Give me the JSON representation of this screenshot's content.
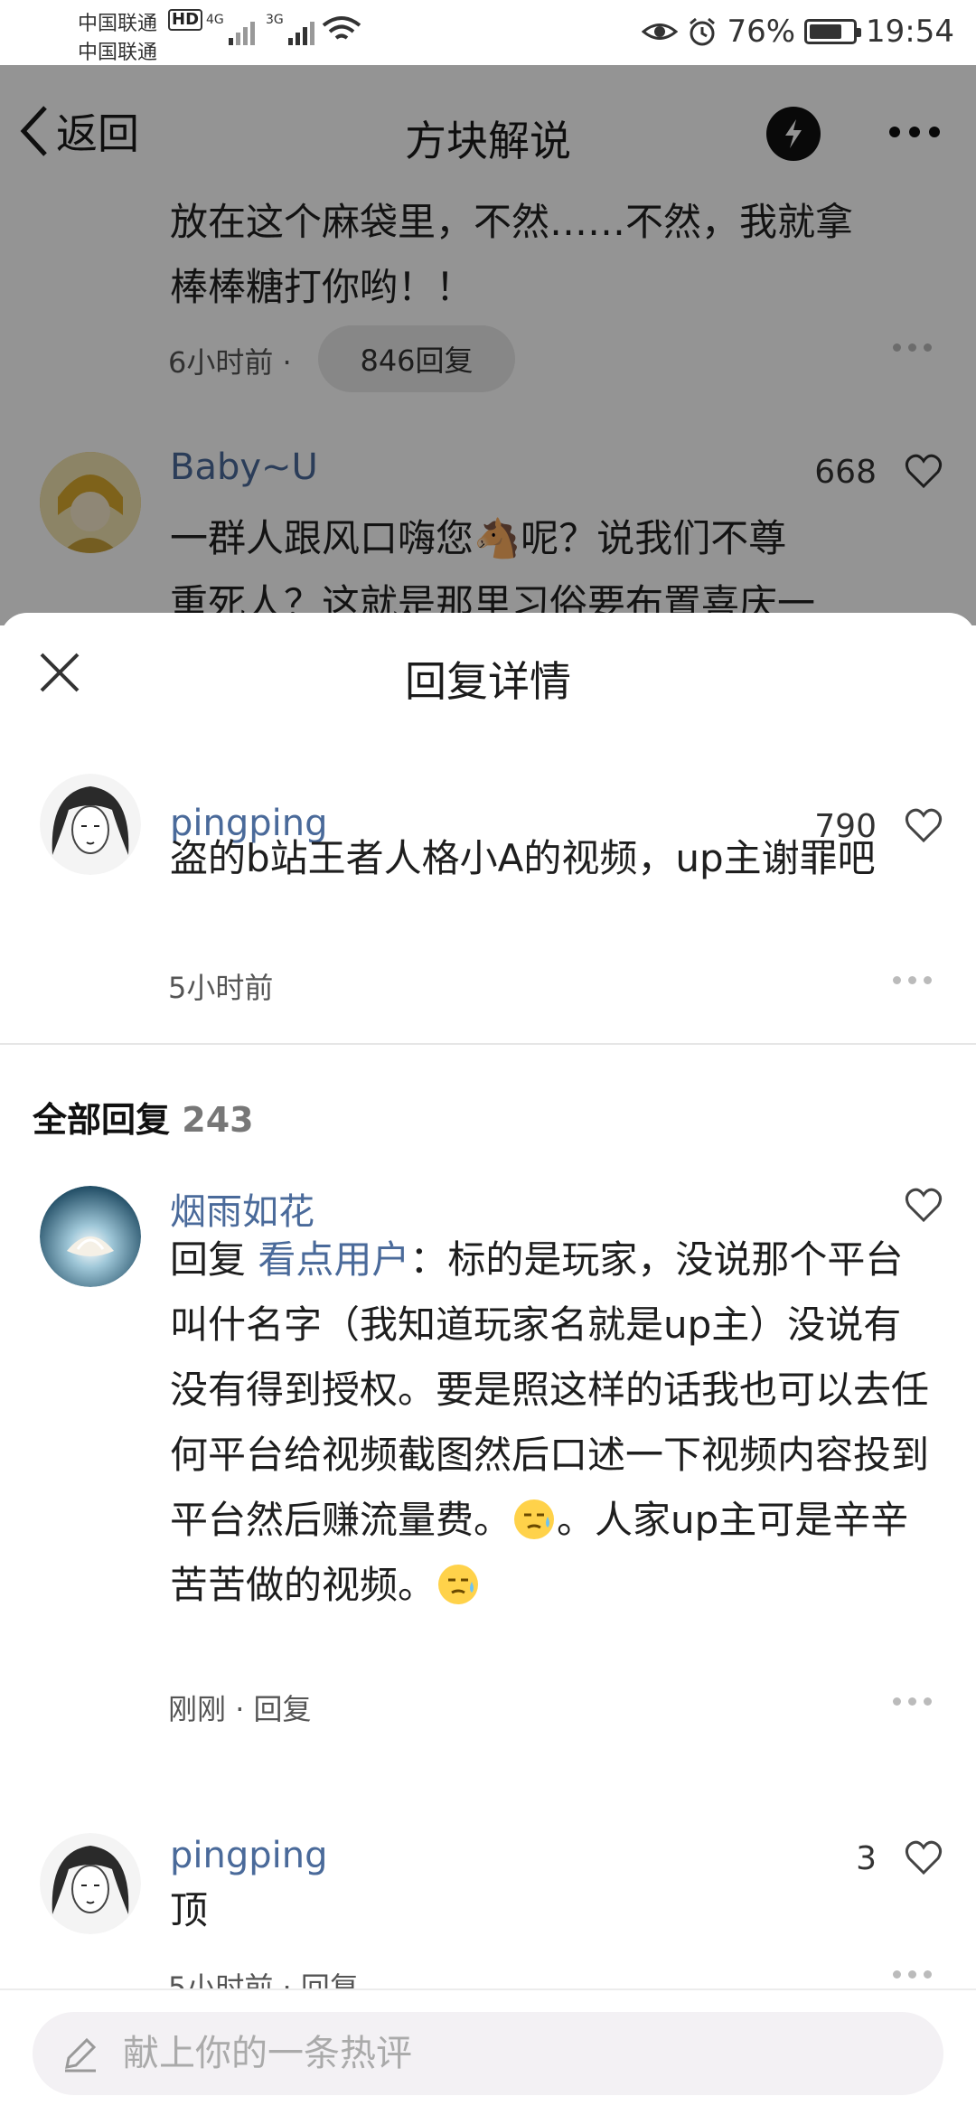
{
  "status_bar": {
    "carrier1": "中国联通",
    "carrier2": "中国联通",
    "hd": "HD",
    "net1": "4G",
    "net2": "3G",
    "battery_text": "76%",
    "battery_level": 0.76,
    "time": "19:54"
  },
  "nav": {
    "back_label": "返回",
    "title": "方块解说"
  },
  "background": {
    "comment_text_line1": "放在这个麻袋里，不然……不然，我就拿",
    "comment_text_line2": "棒棒糖打你哟！！",
    "comment_time": "6小时前 ·",
    "reply_count_pill": "846回复",
    "second_user": "Baby~U",
    "second_likes": "668",
    "second_text_line1": "一群人跟风口嗨您🐴呢？说我们不尊",
    "second_text_line2": "重死人？这就是那里习俗要布置喜庆一"
  },
  "sheet": {
    "title": "回复详情",
    "main_comment": {
      "user": "pingping",
      "likes": "790",
      "text": "盗的b站王者人格小A的视频，up主谢罪吧",
      "time": "5小时前"
    },
    "all_replies_label": "全部回复",
    "all_replies_count": "243",
    "replies": [
      {
        "user": "烟雨如花",
        "reply_prefix": "回复",
        "reply_to": "看点用户",
        "text_part1": "：标的是玩家，没说那个平台叫什名字（我知道玩家名就是up主）没说有没有得到授权。要是照这样的话我也可以去任何平台给视频截图然后口述一下视频内容投到平台然后赚流量费。",
        "text_part2": "。人家up主可是辛辛苦苦做的视频。",
        "time": "刚刚",
        "reply_action": "回复"
      },
      {
        "user": "pingping",
        "likes": "3",
        "text": "顶",
        "time": "5小时前",
        "reply_action": "回复"
      }
    ]
  },
  "bottom": {
    "placeholder": "献上你的一条热评"
  }
}
